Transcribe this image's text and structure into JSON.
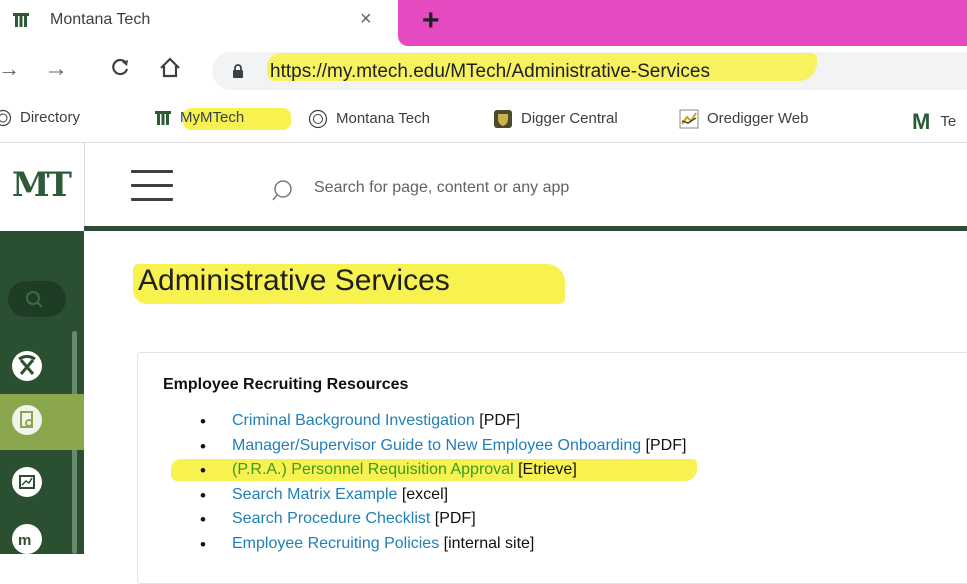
{
  "browser": {
    "tab": {
      "title": "Montana Tech",
      "close": "×",
      "new_tab": "+"
    },
    "url": "https://my.mtech.edu/MTech/Administrative-Services",
    "bookmarks": [
      {
        "label": "Directory",
        "icon": "seal-icon"
      },
      {
        "label": "MyMTech",
        "icon": "mt-logo-icon"
      },
      {
        "label": "Montana Tech",
        "icon": "seal-icon"
      },
      {
        "label": "Digger Central",
        "icon": "shield-icon"
      },
      {
        "label": "Oredigger Web",
        "icon": "chart-icon"
      },
      {
        "label": "Te",
        "icon": "m-logo-icon"
      }
    ]
  },
  "header": {
    "logo": "MT",
    "search_placeholder": "Search for page, content or any app"
  },
  "main": {
    "title": "Administrative Services",
    "card": {
      "heading": "Employee Recruiting Resources",
      "items": [
        {
          "link": "Criminal Background Investigation",
          "note": " [PDF]"
        },
        {
          "link": "Manager/Supervisor Guide to New Employee Onboarding",
          "note": " [PDF]"
        },
        {
          "link": "(P.R.A.) Personnel Requisition Approval",
          "note": " [Etrieve]"
        },
        {
          "link": "Search Matrix Example",
          "note": " [excel]"
        },
        {
          "link": "Search Procedure Checklist",
          "note": " [PDF]"
        },
        {
          "link": "Employee Recruiting Policies",
          "note": " [internal site]"
        }
      ]
    }
  },
  "colors": {
    "brand_green": "#2a5031",
    "active_green": "#8aa74e",
    "link_blue": "#1f7fb6",
    "highlight_yellow": "#f7f250",
    "tab_pink": "#e64ac0"
  }
}
